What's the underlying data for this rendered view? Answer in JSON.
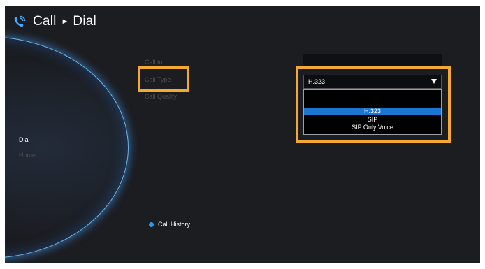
{
  "header": {
    "icon": "phone-call-icon",
    "title": "Call",
    "separator": "►",
    "subtitle": "Dial"
  },
  "nav": {
    "items": [
      {
        "label": "Dial",
        "active": true
      },
      {
        "label": "Home",
        "active": false
      }
    ]
  },
  "form": {
    "labels": {
      "call_to": "Call to",
      "call_type": "Call Type",
      "call_quality": "Call Quality"
    },
    "call_to_value": "",
    "call_type": {
      "selected": "H.323",
      "options": [
        "H.323",
        "SIP",
        "SIP Only Voice"
      ],
      "highlighted_index": 0
    }
  },
  "footer": {
    "call_history_label": "Call History"
  },
  "colors": {
    "highlight": "#f4a933",
    "accent": "#1a76d2",
    "dot": "#2e9be8"
  }
}
